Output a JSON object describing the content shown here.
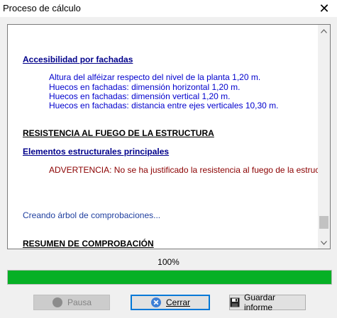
{
  "window": {
    "title": "Proceso de cálculo",
    "close_glyph": "✕"
  },
  "log": {
    "lines": [
      {
        "text": "Accesibilidad por fachadas",
        "style": "heading-blue"
      },
      {
        "text": "Altura del alféizar respecto del nivel de la planta 1,20 m.",
        "style": "text-blue"
      },
      {
        "text": "Huecos en fachadas: dimensión horizontal 1,20 m.",
        "style": "text-blue"
      },
      {
        "text": "Huecos en fachadas: dimensión vertical 1,20 m.",
        "style": "text-blue"
      },
      {
        "text": "Huecos en fachadas: distancia entre ejes verticales 10,30 m.",
        "style": "text-blue"
      },
      {
        "text": "RESISTENCIA AL FUEGO DE LA ESTRUCTURA",
        "style": "heading-black"
      },
      {
        "text": "Elementos estructurales principales",
        "style": "heading-blue"
      },
      {
        "text": "ADVERTENCIA: No se ha justificado la resistencia al fuego de la estructura.",
        "style": "text-red"
      },
      {
        "text": "Creando árbol de comprobaciones...",
        "style": "text-navy"
      },
      {
        "text": "RESUMEN DE COMPROBACIÓN",
        "style": "heading-black"
      }
    ]
  },
  "progress": {
    "label": "100%",
    "value_percent": 100,
    "color": "#06b025"
  },
  "buttons": {
    "pause": {
      "label": "Pausa",
      "enabled": false
    },
    "close": {
      "label": "Cerrar"
    },
    "save": {
      "label": "Guardar informe"
    }
  },
  "icons": {
    "pause": "pause-circle-icon",
    "close": "close-circle-icon",
    "save": "floppy-disk-icon"
  }
}
